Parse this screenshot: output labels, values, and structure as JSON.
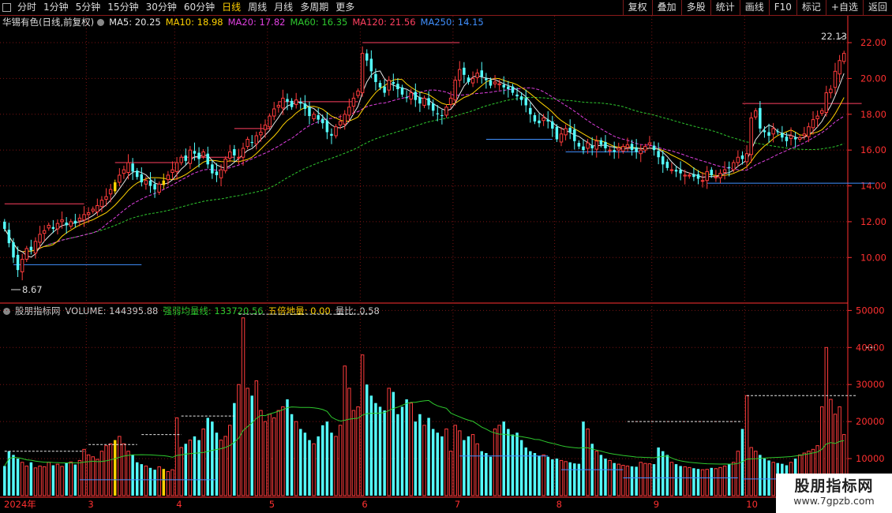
{
  "toolbar": {
    "periods": [
      "分时",
      "1分钟",
      "5分钟",
      "15分钟",
      "30分钟",
      "60分钟",
      "日线",
      "周线",
      "月线",
      "多周期",
      "更多"
    ],
    "active_period": "日线",
    "buttons": [
      "复权",
      "叠加",
      "多股",
      "统计",
      "画线",
      "F10",
      "标记",
      "+自选",
      "返回"
    ]
  },
  "main_legend": {
    "title": "华锡有色(日线,前复权)",
    "ma": [
      {
        "label": "MA5: 20.25",
        "color": "#e6e6e6"
      },
      {
        "label": "MA10: 18.98",
        "color": "#ffd200"
      },
      {
        "label": "MA20: 17.82",
        "color": "#e040e0"
      },
      {
        "label": "MA60: 16.35",
        "color": "#2ec82e"
      },
      {
        "label": "MA120: 21.56",
        "color": "#ff4060"
      },
      {
        "label": "MA250: 14.15",
        "color": "#4090ff"
      }
    ]
  },
  "volume_legend": {
    "items": [
      {
        "label": "股朋指标网",
        "color": "#cccccc"
      },
      {
        "label": "VOLUME: 144395.88",
        "color": "#cccccc"
      },
      {
        "label": "强弱均量线: 133720.56",
        "color": "#2ec82e"
      },
      {
        "label": "五倍地量: 0.00",
        "color": "#ffd200"
      },
      {
        "label": "量比: 0.58",
        "color": "#cccccc"
      }
    ]
  },
  "price_axis": [
    "22.00",
    "20.00",
    "18.00",
    "16.00",
    "14.00",
    "12.00",
    "10.00"
  ],
  "volume_axis": [
    "50000",
    "40000",
    "30000",
    "20000",
    "10000"
  ],
  "date_axis": [
    "2024年",
    "3",
    "4",
    "5",
    "6",
    "7",
    "8",
    "9",
    "10"
  ],
  "annotations": {
    "high": "22.13",
    "low": "8.67"
  },
  "watermark": {
    "title": "股朋指标网",
    "url": "www.7gpzb.com"
  },
  "colors": {
    "up": "#ff3c3c",
    "down": "#54ffff",
    "grid": "#7a1414",
    "axis": "#ff3030",
    "ma250": "#4090ff",
    "ma120": "#ff4060"
  },
  "chart_data": {
    "type": "candlestick",
    "price_ylim": [
      7.5,
      23.5
    ],
    "volume_ylim": [
      0,
      52000
    ],
    "months": [
      {
        "label": "2024年",
        "start": 0
      },
      {
        "label": "3",
        "start": 19
      },
      {
        "label": "4",
        "start": 39
      },
      {
        "label": "5",
        "start": 60
      },
      {
        "label": "6",
        "start": 81
      },
      {
        "label": "7",
        "start": 102
      },
      {
        "label": "8",
        "start": 125
      },
      {
        "label": "9",
        "start": 147
      },
      {
        "label": "10",
        "start": 168
      }
    ],
    "close": [
      11.6,
      10.8,
      10.0,
      9.3,
      9.9,
      10.5,
      10.4,
      10.9,
      11.3,
      11.5,
      11.8,
      11.6,
      11.9,
      12.1,
      11.8,
      12.0,
      11.9,
      12.2,
      12.4,
      12.5,
      12.7,
      12.9,
      13.2,
      13.4,
      13.8,
      14.2,
      14.6,
      14.9,
      15.3,
      14.8,
      14.5,
      14.2,
      14.3,
      14.0,
      13.8,
      14.1,
      14.3,
      14.6,
      14.9,
      15.3,
      15.6,
      15.4,
      16.0,
      15.8,
      15.5,
      15.9,
      15.2,
      14.7,
      14.6,
      14.9,
      15.5,
      15.9,
      15.7,
      15.6,
      16.1,
      16.6,
      16.4,
      16.8,
      17.0,
      17.4,
      17.9,
      18.3,
      18.5,
      18.9,
      18.7,
      18.4,
      18.8,
      18.6,
      18.3,
      17.9,
      18.0,
      17.7,
      17.5,
      17.0,
      16.8,
      17.3,
      17.6,
      18.0,
      18.4,
      18.9,
      19.3,
      21.4,
      21.0,
      20.4,
      19.8,
      19.5,
      19.2,
      19.9,
      19.7,
      19.4,
      19.1,
      18.9,
      19.2,
      18.8,
      18.6,
      18.9,
      18.5,
      18.2,
      18.0,
      17.9,
      18.4,
      18.9,
      19.9,
      20.5,
      20.2,
      19.8,
      20.0,
      20.3,
      20.1,
      19.9,
      19.6,
      19.8,
      19.7,
      19.5,
      19.4,
      19.2,
      19.0,
      18.8,
      18.5,
      18.0,
      17.6,
      17.5,
      17.8,
      17.6,
      17.2,
      16.6,
      16.9,
      17.2,
      17.0,
      16.5,
      16.2,
      16.0,
      16.4,
      16.1,
      16.5,
      16.3,
      16.1,
      16.0,
      15.9,
      16.1,
      16.2,
      16.3,
      16.0,
      15.9,
      16.0,
      16.2,
      16.4,
      16.0,
      15.6,
      15.2,
      15.0,
      14.9,
      14.8,
      14.7,
      14.6,
      14.6,
      14.5,
      14.4,
      14.3,
      14.8,
      14.6,
      14.5,
      14.7,
      14.9,
      15.0,
      15.3,
      15.6,
      15.5,
      15.8,
      17.8,
      18.2,
      17.2,
      17.0,
      16.8,
      17.2,
      17.0,
      16.7,
      16.5,
      16.8,
      16.6,
      16.7,
      16.9,
      17.3,
      17.7,
      17.9,
      18.2,
      19.2,
      19.4,
      20.4,
      21.0,
      21.4
    ],
    "volume": [
      8000,
      12000,
      11000,
      10000,
      9000,
      8000,
      9000,
      7500,
      8000,
      7800,
      9000,
      8200,
      8500,
      7900,
      8800,
      9100,
      8400,
      9500,
      12500,
      11000,
      10500,
      9800,
      12000,
      13500,
      14000,
      15000,
      16000,
      14000,
      12000,
      11000,
      9000,
      8500,
      8000,
      7500,
      7000,
      7800,
      7200,
      6500,
      7000,
      21000,
      13000,
      14000,
      15000,
      16000,
      15000,
      18000,
      21000,
      20000,
      17000,
      15000,
      16000,
      19000,
      25000,
      30000,
      48000,
      29000,
      27000,
      31000,
      23000,
      20000,
      22000,
      21000,
      23000,
      24000,
      26000,
      22000,
      20000,
      18000,
      17000,
      15000,
      14000,
      16000,
      19000,
      20000,
      17000,
      16000,
      19000,
      35000,
      29000,
      23000,
      24000,
      38000,
      30000,
      27000,
      25000,
      24000,
      23000,
      29000,
      28000,
      22000,
      24000,
      26000,
      25000,
      20000,
      22000,
      19000,
      21000,
      18000,
      17000,
      16000,
      18000,
      12000,
      19000,
      17500,
      15000,
      16000,
      16500,
      14000,
      12000,
      11500,
      10500,
      18000,
      19000,
      20000,
      18000,
      16500,
      17000,
      15000,
      13000,
      12000,
      11500,
      10800,
      11000,
      10500,
      9800,
      10000,
      9500,
      9200,
      9000,
      8700,
      8600,
      20000,
      18000,
      14000,
      12000,
      11000,
      10000,
      9500,
      8800,
      8500,
      8200,
      8000,
      7900,
      7800,
      9000,
      8700,
      8600,
      8500,
      13000,
      12000,
      11000,
      9000,
      8500,
      8000,
      7800,
      7600,
      7400,
      7200,
      7000,
      7100,
      7500,
      7300,
      7600,
      8000,
      8500,
      9000,
      12000,
      18000,
      27000,
      13000,
      12000,
      11000,
      10000,
      9500,
      9000,
      8800,
      8600,
      8200,
      9000,
      10000,
      11000,
      11500,
      12000,
      12500,
      13500,
      24000,
      40000,
      26000,
      22000,
      24000,
      16500
    ]
  }
}
